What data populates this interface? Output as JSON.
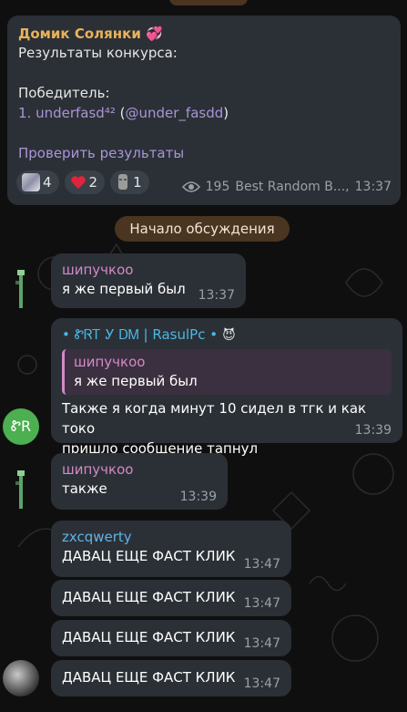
{
  "channel": {
    "title": "Домик Солянки 💞",
    "line1": "Результаты конкурса:",
    "winner_label": "Победитель:",
    "winner_num": "1. underfasd⁴²",
    "winner_handle_pre": " (",
    "winner_handle": "@under_fasdd",
    "winner_handle_post": ")",
    "check_link": "Проверить результаты",
    "reactions": [
      {
        "icon": "image",
        "count": "4"
      },
      {
        "icon": "heart",
        "count": "2"
      },
      {
        "icon": "statue",
        "count": "1"
      }
    ],
    "views": "195",
    "bot": "Best Random B...,",
    "time": "13:37"
  },
  "divider_text": "Начало обсуждения",
  "messages": [
    {
      "sender": "шипучкоо",
      "text": "я же первый был",
      "time": "13:37"
    },
    {
      "sender": "• ᏑᏒᎢ Ꭹ ᎠᎷ | RasulPc •",
      "sender_emoji": "😈",
      "quote_sender": "шипучкоо",
      "quote_text": "я же первый был",
      "text1": "Также я когда минут 10 сидел в тгк и как токо",
      "text2": "пришло сообщение тапнул",
      "time": "13:39",
      "avatar_text": "ᏑR"
    },
    {
      "sender": "шипучкоо",
      "text": "также",
      "time": "13:39"
    },
    {
      "sender": "zxcqwerty",
      "text": "ДАВАЦ ЕЩЕ ФАСТ КЛИК",
      "time": "13:47"
    },
    {
      "text": "ДАВАЦ ЕЩЕ ФАСТ КЛИК",
      "time": "13:47"
    },
    {
      "text": "ДАВАЦ ЕЩЕ ФАСТ КЛИК",
      "time": "13:47"
    },
    {
      "text": "ДАВАЦ ЕЩЕ ФАСТ КЛИК",
      "time": "13:47"
    }
  ],
  "colors": {
    "bubble": "#2b3036",
    "accent_gold": "#e9b25a",
    "accent_purple": "#a995d8",
    "accent_pink": "#d489c7",
    "accent_blue": "#4bb7e6",
    "divider": "#4a3520"
  }
}
